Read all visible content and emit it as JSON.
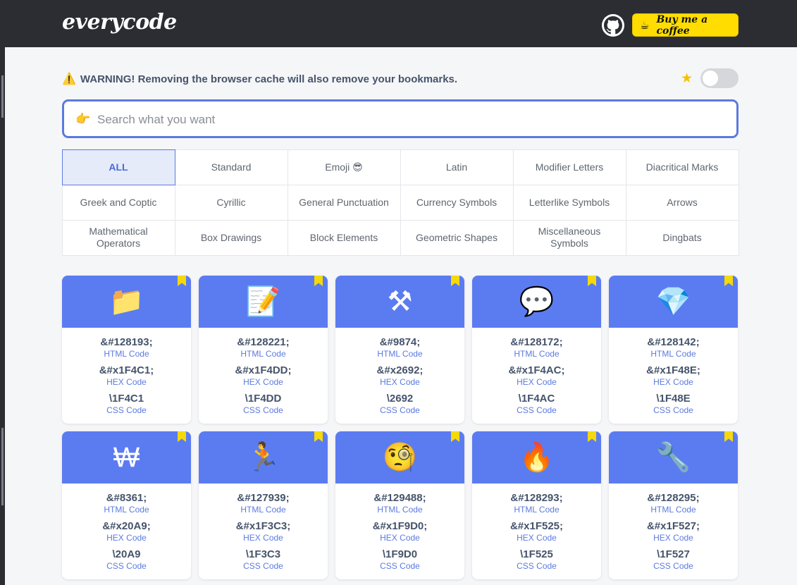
{
  "header": {
    "logo": "everycode",
    "coffee_label": "Buy me a coffee",
    "coffee_icon": "☕"
  },
  "warning": {
    "icon": "⚠️",
    "text": "WARNING! Removing the browser cache will also remove your bookmarks."
  },
  "search": {
    "icon": "👉",
    "placeholder": "Search what you want",
    "value": ""
  },
  "categories": [
    {
      "label": "ALL",
      "active": true
    },
    {
      "label": "Standard"
    },
    {
      "label": "Emoji 😎"
    },
    {
      "label": "Latin"
    },
    {
      "label": "Modifier Letters"
    },
    {
      "label": "Diacritical Marks"
    },
    {
      "label": "Greek and Coptic"
    },
    {
      "label": "Cyrillic"
    },
    {
      "label": "General Punctuation"
    },
    {
      "label": "Currency Symbols"
    },
    {
      "label": "Letterlike Symbols"
    },
    {
      "label": "Arrows"
    },
    {
      "label": "Mathematical Operators"
    },
    {
      "label": "Box Drawings"
    },
    {
      "label": "Block Elements"
    },
    {
      "label": "Geometric Shapes"
    },
    {
      "label": "Miscellaneous Symbols"
    },
    {
      "label": "Dingbats"
    }
  ],
  "code_labels": {
    "html": "HTML Code",
    "hex": "HEX Code",
    "css": "CSS Code"
  },
  "cards": [
    {
      "glyph": "📁",
      "html": "&#128193;",
      "hex": "&#x1F4C1;",
      "css": "\\1F4C1"
    },
    {
      "glyph": "📝",
      "html": "&#128221;",
      "hex": "&#x1F4DD;",
      "css": "\\1F4DD"
    },
    {
      "glyph": "⚒",
      "html": "&#9874;",
      "hex": "&#x2692;",
      "css": "\\2692"
    },
    {
      "glyph": "💬",
      "html": "&#128172;",
      "hex": "&#x1F4AC;",
      "css": "\\1F4AC"
    },
    {
      "glyph": "💎",
      "html": "&#128142;",
      "hex": "&#x1F48E;",
      "css": "\\1F48E"
    },
    {
      "glyph": "₩",
      "html": "&#8361;",
      "hex": "&#x20A9;",
      "css": "\\20A9"
    },
    {
      "glyph": "🏃",
      "html": "&#127939;",
      "hex": "&#x1F3C3;",
      "css": "\\1F3C3"
    },
    {
      "glyph": "🧐",
      "html": "&#129488;",
      "hex": "&#x1F9D0;",
      "css": "\\1F9D0"
    },
    {
      "glyph": "🔥",
      "html": "&#128293;",
      "hex": "&#x1F525;",
      "css": "\\1F525"
    },
    {
      "glyph": "🔧",
      "html": "&#128295;",
      "hex": "&#x1F527;",
      "css": "\\1F527"
    }
  ],
  "colors": {
    "accent": "#5b7cf1",
    "bookmark": "#f5d90a",
    "coffee": "#ffdd00",
    "header_bg": "#2b2d33"
  }
}
